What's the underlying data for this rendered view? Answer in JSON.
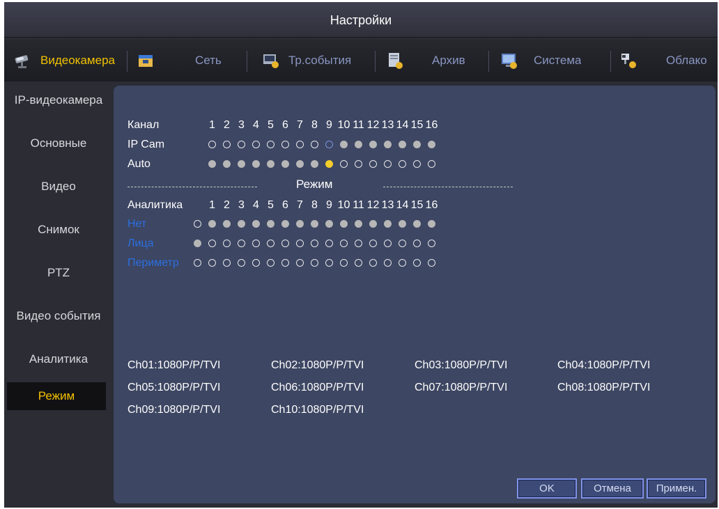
{
  "window": {
    "title": "Настройки"
  },
  "tabs": [
    {
      "label": "Видеокамера",
      "icon": "camera-icon",
      "active": true
    },
    {
      "label": "Сеть",
      "icon": "network-icon",
      "active": false
    },
    {
      "label": "Тр.события",
      "icon": "alarm-event-icon",
      "active": false
    },
    {
      "label": "Архив",
      "icon": "storage-icon",
      "active": false
    },
    {
      "label": "Система",
      "icon": "system-icon",
      "active": false
    },
    {
      "label": "Облако",
      "icon": "cloud-icon",
      "active": false
    }
  ],
  "sidebar": {
    "items": [
      {
        "label": "IP-видеокамера",
        "active": false
      },
      {
        "label": "Основные",
        "active": false
      },
      {
        "label": "Видео",
        "active": false
      },
      {
        "label": "Снимок",
        "active": false
      },
      {
        "label": "PTZ",
        "active": false
      },
      {
        "label": "Видео события",
        "active": false
      },
      {
        "label": "Аналитика",
        "active": false
      },
      {
        "label": "Режим",
        "active": true
      }
    ]
  },
  "mode": {
    "channel_label": "Канал",
    "channels": [
      "1",
      "2",
      "3",
      "4",
      "5",
      "6",
      "7",
      "8",
      "9",
      "10",
      "11",
      "12",
      "13",
      "14",
      "15",
      "16"
    ],
    "ipcam_label": "IP Cam",
    "auto_label": "Auto",
    "ipcam_states": [
      "empty",
      "empty",
      "empty",
      "empty",
      "empty",
      "empty",
      "empty",
      "empty",
      "blue",
      "filled",
      "filled",
      "filled",
      "filled",
      "filled",
      "filled",
      "filled"
    ],
    "auto_states": [
      "filled",
      "filled",
      "filled",
      "filled",
      "filled",
      "filled",
      "filled",
      "filled",
      "yellow",
      "empty",
      "empty",
      "empty",
      "empty",
      "empty",
      "empty",
      "empty"
    ],
    "section_title": "Режим",
    "analytics_label": "Аналитика",
    "analytics_channels": [
      "1",
      "2",
      "3",
      "4",
      "5",
      "6",
      "7",
      "8",
      "9",
      "10",
      "11",
      "12",
      "13",
      "14",
      "15",
      "16"
    ],
    "analytics_rows": [
      {
        "label": "Нет",
        "states": [
          "empty",
          "filled",
          "filled",
          "filled",
          "filled",
          "filled",
          "filled",
          "filled",
          "filled",
          "filled",
          "filled",
          "filled",
          "filled",
          "filled",
          "filled",
          "filled",
          "filled"
        ]
      },
      {
        "label": "Лица",
        "states": [
          "filled",
          "empty",
          "empty",
          "empty",
          "empty",
          "empty",
          "empty",
          "empty",
          "empty",
          "empty",
          "empty",
          "empty",
          "empty",
          "empty",
          "empty",
          "empty",
          "empty"
        ]
      },
      {
        "label": "Периметр",
        "states": [
          "empty",
          "empty",
          "empty",
          "empty",
          "empty",
          "empty",
          "empty",
          "empty",
          "empty",
          "empty",
          "empty",
          "empty",
          "empty",
          "empty",
          "empty",
          "empty",
          "empty"
        ]
      }
    ]
  },
  "channel_info": [
    "Ch01:1080P/P/TVI",
    "Ch02:1080P/P/TVI",
    "Ch03:1080P/P/TVI",
    "Ch04:1080P/P/TVI",
    "Ch05:1080P/P/TVI",
    "Ch06:1080P/P/TVI",
    "Ch07:1080P/P/TVI",
    "Ch08:1080P/P/TVI",
    "Ch09:1080P/P/TVI",
    "Ch10:1080P/P/TVI"
  ],
  "buttons": {
    "ok": "OK",
    "cancel": "Отмена",
    "apply": "Примен."
  },
  "colors": {
    "accent": "#f2c200",
    "link_blue": "#2b6fe0",
    "panel": "#3d4662"
  }
}
